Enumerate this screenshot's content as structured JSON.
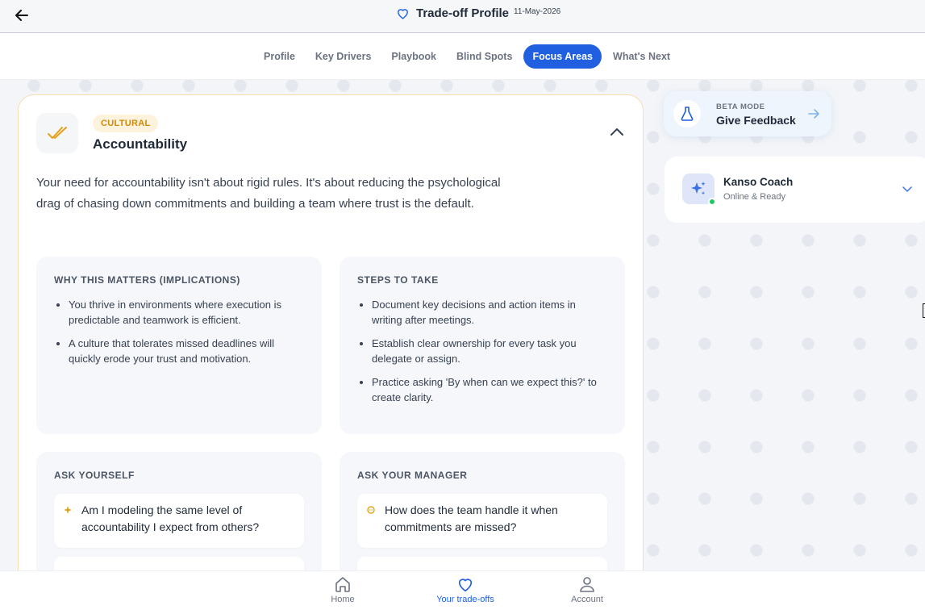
{
  "header": {
    "title": "Trade-off Profile",
    "date": "11-May-2026"
  },
  "tabs": [
    {
      "label": "Profile"
    },
    {
      "label": "Key Drivers"
    },
    {
      "label": "Playbook"
    },
    {
      "label": "Blind Spots"
    },
    {
      "label": "Focus Areas",
      "active": true
    },
    {
      "label": "What's Next"
    }
  ],
  "focus": {
    "badge": "CULTURAL",
    "title": "Accountability",
    "description": "Your need for accountability isn't about rigid rules. It's about reducing the psychological drag of chasing down commitments and building a team where trust is the default.",
    "why": {
      "heading": "WHY THIS MATTERS (IMPLICATIONS)",
      "items": [
        "You thrive in environments where execution is predictable and teamwork is efficient.",
        "A culture that tolerates missed deadlines will quickly erode your trust and motivation."
      ]
    },
    "steps": {
      "heading": "STEPS TO TAKE",
      "items": [
        "Document key decisions and action items in writing after meetings.",
        "Establish clear ownership for every task you delegate or assign.",
        "Practice asking 'By when can we expect this?' to create clarity."
      ]
    },
    "ask_yourself": {
      "heading": "ASK YOURSELF",
      "questions": [
        "Am I modeling the same level of accountability I expect from others?"
      ]
    },
    "ask_manager": {
      "heading": "ASK YOUR MANAGER",
      "questions": [
        "How does the team handle it when commitments are missed?"
      ]
    }
  },
  "beta": {
    "label": "BETA MODE",
    "title": "Give Feedback"
  },
  "coach": {
    "name": "Kanso Coach",
    "status": "Online & Ready"
  },
  "bottom_nav": [
    {
      "label": "Home",
      "icon": "home-icon"
    },
    {
      "label": "Your trade-offs",
      "icon": "heart-icon",
      "active": true
    },
    {
      "label": "Account",
      "icon": "user-icon"
    }
  ],
  "colors": {
    "accent": "#1f5fe0",
    "badge_text": "#d08a0c",
    "badge_bg": "#fdf3dc",
    "card_border": "#f5dfb3",
    "online": "#22c55e"
  }
}
